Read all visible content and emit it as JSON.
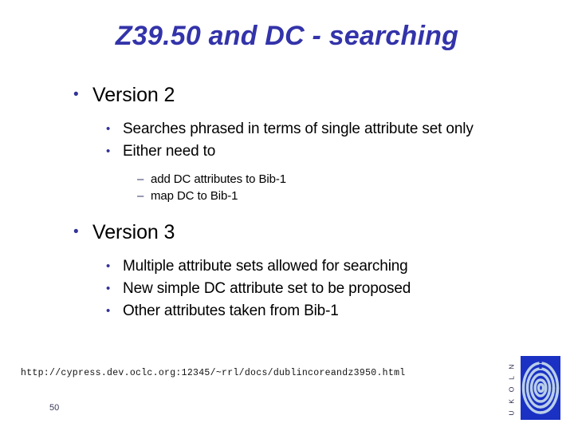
{
  "slide": {
    "title": "Z39.50 and DC - searching",
    "page_number": "50",
    "footer_url": "http://cypress.dev.oclc.org:12345/~rrl/docs/dublincoreandz3950.html",
    "title_color": "#3333aa",
    "bullet_color": "#333399",
    "dash_color": "#333366",
    "background_color": "#ffffff",
    "bullet_glyph": "•",
    "dash_glyph": "–",
    "content": [
      {
        "level": 1,
        "text": "Version 2"
      },
      {
        "level": 2,
        "text": "Searches phrased in terms of single attribute set only"
      },
      {
        "level": 2,
        "text": "Either need to"
      },
      {
        "level": 3,
        "text": "add DC attributes to Bib-1"
      },
      {
        "level": 3,
        "text": "map DC to Bib-1"
      },
      {
        "level": 1,
        "text": "Version 3"
      },
      {
        "level": 2,
        "text": "Multiple attribute sets allowed for searching"
      },
      {
        "level": 2,
        "text": "New simple DC attribute set to be proposed"
      },
      {
        "level": 2,
        "text": "Other attributes taken from Bib-1"
      }
    ]
  },
  "logo": {
    "name": "UKOLN",
    "letters": "U K O L N",
    "square_color": "#1a31c4",
    "spiral_color": "#b9cfe8"
  }
}
